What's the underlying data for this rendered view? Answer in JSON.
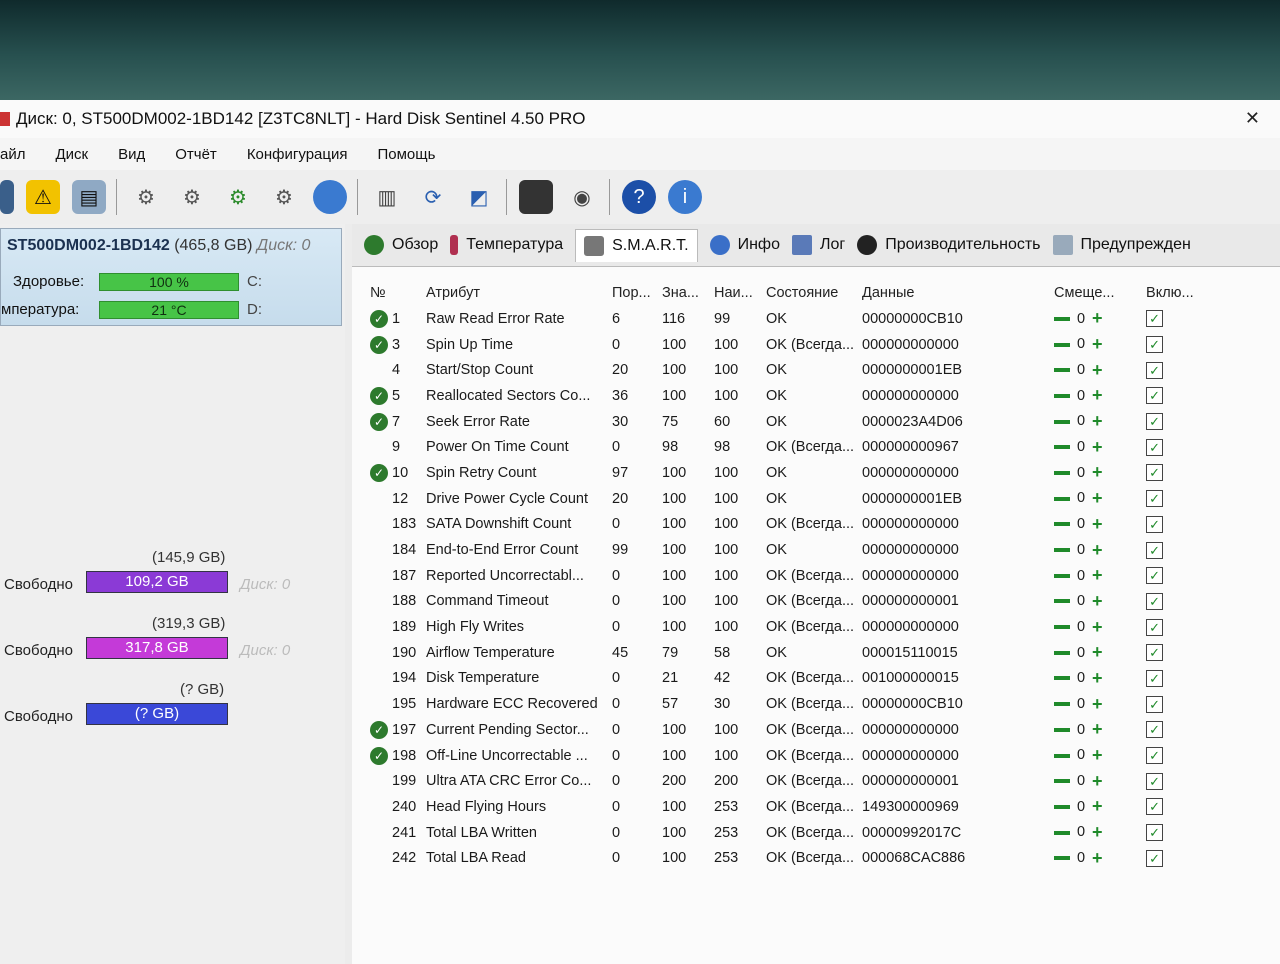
{
  "window": {
    "title": "Диск: 0, ST500DM002-1BD142 [Z3TC8NLT]  -  Hard Disk Sentinel 4.50 PRO"
  },
  "menu": [
    "айл",
    "Диск",
    "Вид",
    "Отчёт",
    "Конфигурация",
    "Помощь"
  ],
  "left": {
    "disk_name": "ST500DM002-1BD142",
    "disk_size": "(465,8 GB)",
    "disk_num": "Диск: 0",
    "health_label": "Здоровье:",
    "health_value": "100 %",
    "health_pct": 100,
    "health_drive": "C:",
    "temp_label": "мпература:",
    "temp_value": "21 °C",
    "temp_drive": "D:",
    "volumes": [
      {
        "capacity": "(145,9 GB)",
        "free_label": "Свободно",
        "free_value": "109,2 GB",
        "color": "#8b3ad6",
        "ghost": "Диск: 0"
      },
      {
        "capacity": "(319,3 GB)",
        "free_label": "Свободно",
        "free_value": "317,8 GB",
        "color": "#c43ad8",
        "ghost": "Диск: 0"
      },
      {
        "capacity": "(? GB)",
        "free_label": "Свободно",
        "free_value": "(? GB)",
        "color": "#3a48d8",
        "ghost": ""
      }
    ]
  },
  "tabs": [
    {
      "label": "Обзор",
      "icon": "check-circle-icon"
    },
    {
      "label": "Температура",
      "icon": "thermometer-icon"
    },
    {
      "label": "S.M.A.R.T.",
      "icon": "smart-icon"
    },
    {
      "label": "Инфо",
      "icon": "info-icon"
    },
    {
      "label": "Лог",
      "icon": "log-icon"
    },
    {
      "label": "Производительность",
      "icon": "performance-icon"
    },
    {
      "label": "Предупрежден",
      "icon": "warning-doc-icon"
    }
  ],
  "table": {
    "headers": [
      "№",
      "Атрибут",
      "Пор...",
      "Зна...",
      "Наи...",
      "Состояние",
      "Данные",
      "Смеще...",
      "Вклю..."
    ],
    "rows": [
      {
        "ic": true,
        "id": "1",
        "name": "Raw Read Error Rate",
        "thr": "6",
        "val": "116",
        "worst": "99",
        "status": "OK",
        "data": "00000000CB10",
        "offset": "0"
      },
      {
        "ic": true,
        "id": "3",
        "name": "Spin Up Time",
        "thr": "0",
        "val": "100",
        "worst": "100",
        "status": "OK (Всегда...",
        "data": "000000000000",
        "offset": "0"
      },
      {
        "ic": false,
        "id": "4",
        "name": "Start/Stop Count",
        "thr": "20",
        "val": "100",
        "worst": "100",
        "status": "OK",
        "data": "0000000001EB",
        "offset": "0"
      },
      {
        "ic": true,
        "id": "5",
        "name": "Reallocated Sectors Co...",
        "thr": "36",
        "val": "100",
        "worst": "100",
        "status": "OK",
        "data": "000000000000",
        "offset": "0"
      },
      {
        "ic": true,
        "id": "7",
        "name": "Seek Error Rate",
        "thr": "30",
        "val": "75",
        "worst": "60",
        "status": "OK",
        "data": "0000023A4D06",
        "offset": "0"
      },
      {
        "ic": false,
        "id": "9",
        "name": "Power On Time Count",
        "thr": "0",
        "val": "98",
        "worst": "98",
        "status": "OK (Всегда...",
        "data": "000000000967",
        "offset": "0"
      },
      {
        "ic": true,
        "id": "10",
        "name": "Spin Retry Count",
        "thr": "97",
        "val": "100",
        "worst": "100",
        "status": "OK",
        "data": "000000000000",
        "offset": "0"
      },
      {
        "ic": false,
        "id": "12",
        "name": "Drive Power Cycle Count",
        "thr": "20",
        "val": "100",
        "worst": "100",
        "status": "OK",
        "data": "0000000001EB",
        "offset": "0"
      },
      {
        "ic": false,
        "id": "183",
        "name": "SATA Downshift Count",
        "thr": "0",
        "val": "100",
        "worst": "100",
        "status": "OK (Всегда...",
        "data": "000000000000",
        "offset": "0"
      },
      {
        "ic": false,
        "id": "184",
        "name": "End-to-End Error Count",
        "thr": "99",
        "val": "100",
        "worst": "100",
        "status": "OK",
        "data": "000000000000",
        "offset": "0"
      },
      {
        "ic": false,
        "id": "187",
        "name": "Reported Uncorrectabl...",
        "thr": "0",
        "val": "100",
        "worst": "100",
        "status": "OK (Всегда...",
        "data": "000000000000",
        "offset": "0"
      },
      {
        "ic": false,
        "id": "188",
        "name": "Command Timeout",
        "thr": "0",
        "val": "100",
        "worst": "100",
        "status": "OK (Всегда...",
        "data": "000000000001",
        "offset": "0"
      },
      {
        "ic": false,
        "id": "189",
        "name": "High Fly Writes",
        "thr": "0",
        "val": "100",
        "worst": "100",
        "status": "OK (Всегда...",
        "data": "000000000000",
        "offset": "0"
      },
      {
        "ic": false,
        "id": "190",
        "name": "Airflow Temperature",
        "thr": "45",
        "val": "79",
        "worst": "58",
        "status": "OK",
        "data": "000015110015",
        "offset": "0"
      },
      {
        "ic": false,
        "id": "194",
        "name": "Disk Temperature",
        "thr": "0",
        "val": "21",
        "worst": "42",
        "status": "OK (Всегда...",
        "data": "001000000015",
        "offset": "0"
      },
      {
        "ic": false,
        "id": "195",
        "name": "Hardware ECC Recovered",
        "thr": "0",
        "val": "57",
        "worst": "30",
        "status": "OK (Всегда...",
        "data": "00000000CB10",
        "offset": "0"
      },
      {
        "ic": true,
        "id": "197",
        "name": "Current Pending Sector...",
        "thr": "0",
        "val": "100",
        "worst": "100",
        "status": "OK (Всегда...",
        "data": "000000000000",
        "offset": "0"
      },
      {
        "ic": true,
        "id": "198",
        "name": "Off-Line Uncorrectable ...",
        "thr": "0",
        "val": "100",
        "worst": "100",
        "status": "OK (Всегда...",
        "data": "000000000000",
        "offset": "0"
      },
      {
        "ic": false,
        "id": "199",
        "name": "Ultra ATA CRC Error Co...",
        "thr": "0",
        "val": "200",
        "worst": "200",
        "status": "OK (Всегда...",
        "data": "000000000001",
        "offset": "0"
      },
      {
        "ic": false,
        "id": "240",
        "name": "Head Flying Hours",
        "thr": "0",
        "val": "100",
        "worst": "253",
        "status": "OK (Всегда...",
        "data": "149300000969",
        "offset": "0"
      },
      {
        "ic": false,
        "id": "241",
        "name": "Total LBA Written",
        "thr": "0",
        "val": "100",
        "worst": "253",
        "status": "OK (Всегда...",
        "data": "00000992017C",
        "offset": "0"
      },
      {
        "ic": false,
        "id": "242",
        "name": "Total LBA Read",
        "thr": "0",
        "val": "100",
        "worst": "253",
        "status": "OK (Всегда...",
        "data": "000068CAC886",
        "offset": "0"
      }
    ]
  }
}
